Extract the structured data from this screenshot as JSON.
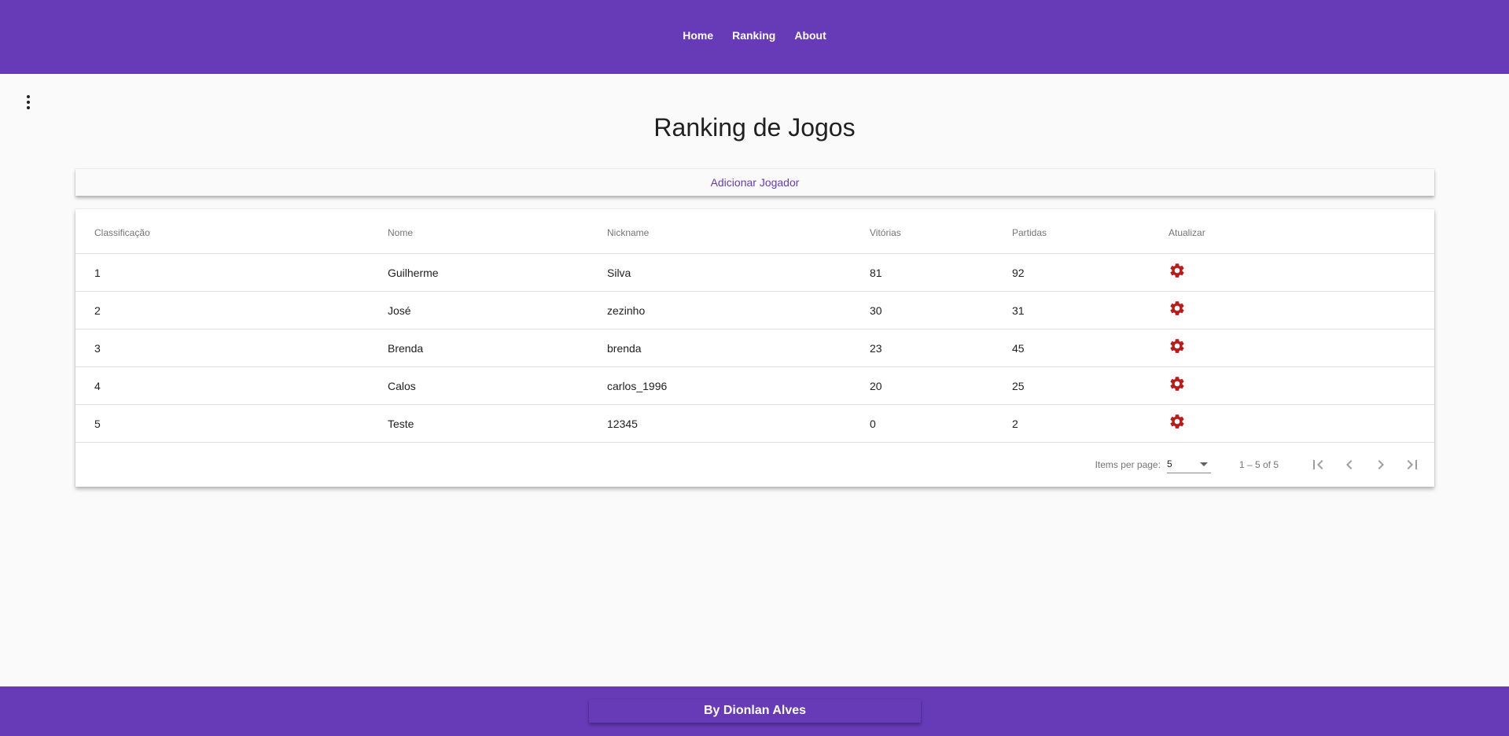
{
  "nav": {
    "home": "Home",
    "ranking": "Ranking",
    "about": "About"
  },
  "page": {
    "title": "Ranking de Jogos",
    "add_button": "Adicionar Jogador"
  },
  "table": {
    "headers": [
      "Classificação",
      "Nome",
      "Nickname",
      "Vitórias",
      "Partidas",
      "Atualizar"
    ],
    "rows": [
      {
        "rank": "1",
        "name": "Guilherme",
        "nickname": "Silva",
        "wins": "81",
        "matches": "92"
      },
      {
        "rank": "2",
        "name": "José",
        "nickname": "zezinho",
        "wins": "30",
        "matches": "31"
      },
      {
        "rank": "3",
        "name": "Brenda",
        "nickname": "brenda",
        "wins": "23",
        "matches": "45"
      },
      {
        "rank": "4",
        "name": "Calos",
        "nickname": "carlos_1996",
        "wins": "20",
        "matches": "25"
      },
      {
        "rank": "5",
        "name": "Teste",
        "nickname": "12345",
        "wins": "0",
        "matches": "2"
      }
    ],
    "update_icon": "gear-icon"
  },
  "paginator": {
    "items_per_page_label": "Items per page:",
    "items_per_page_value": "5",
    "range_label": "1 – 5 of 5"
  },
  "footer": {
    "credit": "By Dionlan Alves"
  },
  "colors": {
    "primary": "#673ab7",
    "gear": "#b71c1c",
    "background": "#fafafa"
  }
}
